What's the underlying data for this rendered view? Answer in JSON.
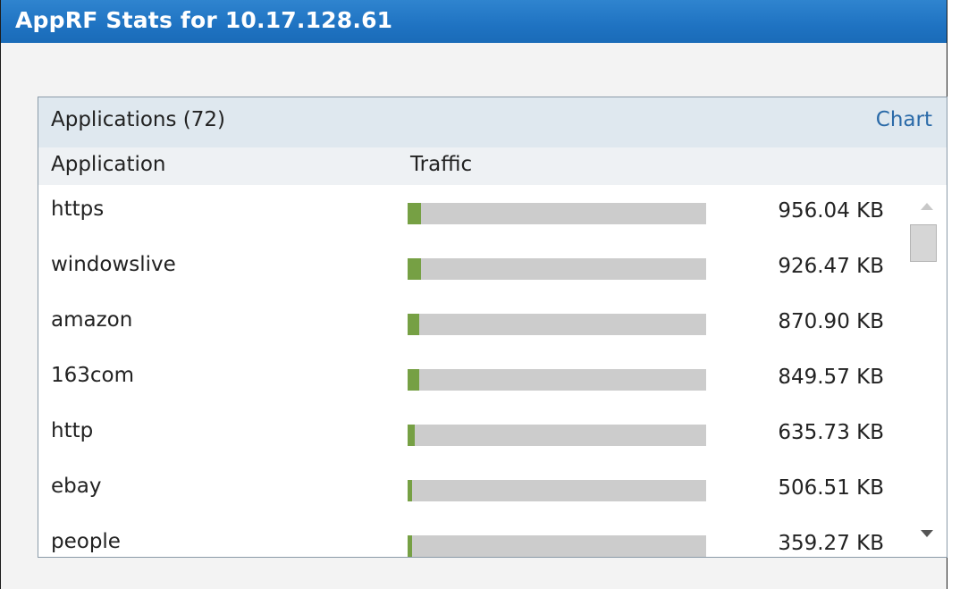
{
  "window": {
    "title": "AppRF Stats for 10.17.128.61"
  },
  "panel": {
    "title": "Applications (72)",
    "chart_link": "Chart",
    "columns": {
      "application": "Application",
      "traffic": "Traffic"
    },
    "rows": [
      {
        "name": "https",
        "value": "956.04 KB",
        "fraction": 0.045
      },
      {
        "name": "windowslive",
        "value": "926.47 KB",
        "fraction": 0.045
      },
      {
        "name": "amazon",
        "value": "870.90 KB",
        "fraction": 0.04
      },
      {
        "name": "163com",
        "value": "849.57 KB",
        "fraction": 0.04
      },
      {
        "name": "http",
        "value": "635.73 KB",
        "fraction": 0.025
      },
      {
        "name": "ebay",
        "value": "506.51 KB",
        "fraction": 0.015
      },
      {
        "name": "people",
        "value": "359.27 KB",
        "fraction": 0.015
      }
    ]
  },
  "colors": {
    "titlebar": "#1f73c2",
    "bar_fill": "#76a044",
    "bar_track": "#cccccc",
    "link": "#2a6aa8"
  }
}
